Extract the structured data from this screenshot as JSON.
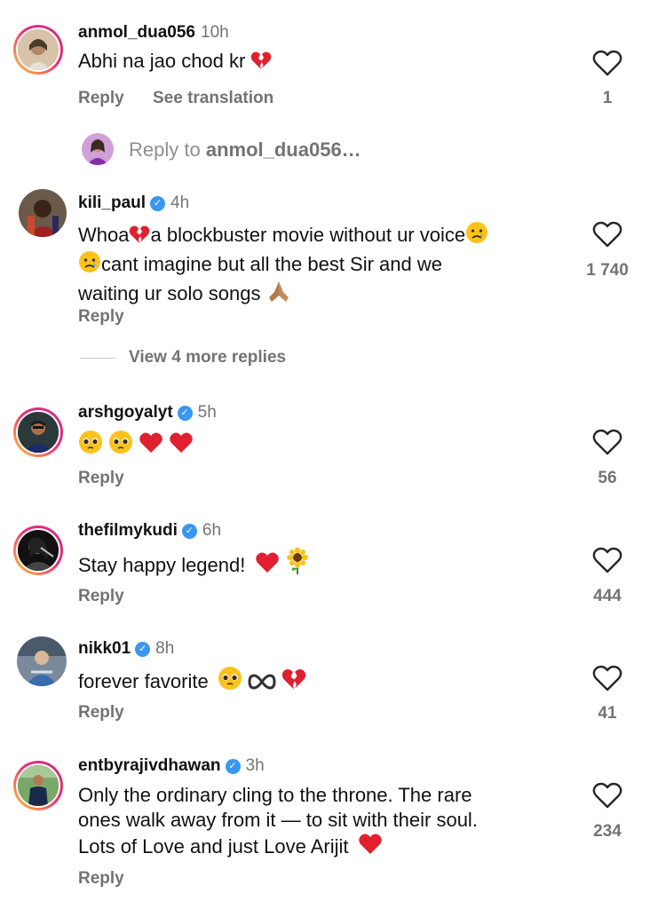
{
  "comments": [
    {
      "username": "anmol_dua056",
      "time": "10h",
      "text": "Abhi na jao chod kr",
      "emojis": [
        "broken-heart"
      ],
      "reply_label": "Reply",
      "translation_label": "See translation",
      "likes": "1"
    },
    {
      "username": "kili_paul",
      "time": "4h",
      "line1": "Whoa",
      "line1b": "a blockbuster movie without ur voice",
      "line2": "cant imagine but all the best Sir and we",
      "line3": "waiting ur solo songs",
      "reply_label": "Reply",
      "likes": "1 740"
    },
    {
      "username": "arshgoyalyt",
      "time": "5h",
      "emojis": [
        "pleading-face",
        "pleading-face",
        "red-heart",
        "red-heart"
      ],
      "reply_label": "Reply",
      "likes": "56"
    },
    {
      "username": "thefilmykudi",
      "time": "6h",
      "text": "Stay happy legend!",
      "emojis": [
        "red-heart",
        "sunflower"
      ],
      "reply_label": "Reply",
      "likes": "444"
    },
    {
      "username": "nikk01",
      "time": "8h",
      "text": "forever favorite",
      "emojis": [
        "pleading-face",
        "infinity",
        "broken-heart"
      ],
      "reply_label": "Reply",
      "likes": "41"
    },
    {
      "username": "entbyrajivdhawan",
      "time": "3h",
      "line1": "Only the ordinary cling to the throne. The rare",
      "line2": "ones walk away from it — to sit with their soul.",
      "line3": "Lots of Love and just Love Arijit",
      "reply_label": "Reply",
      "likes": "234"
    }
  ],
  "reply_to": {
    "prefix": "Reply to",
    "username": "anmol_dua056…"
  },
  "view_more": "View 4 more replies",
  "colors": {
    "verified": "#3897f0",
    "secondary_text": "#737373",
    "heart_red": "#e0202e",
    "story_ring": "#ee2a7b"
  },
  "icons": {
    "like": "heart-outline-icon",
    "verified": "verified-badge-icon"
  }
}
